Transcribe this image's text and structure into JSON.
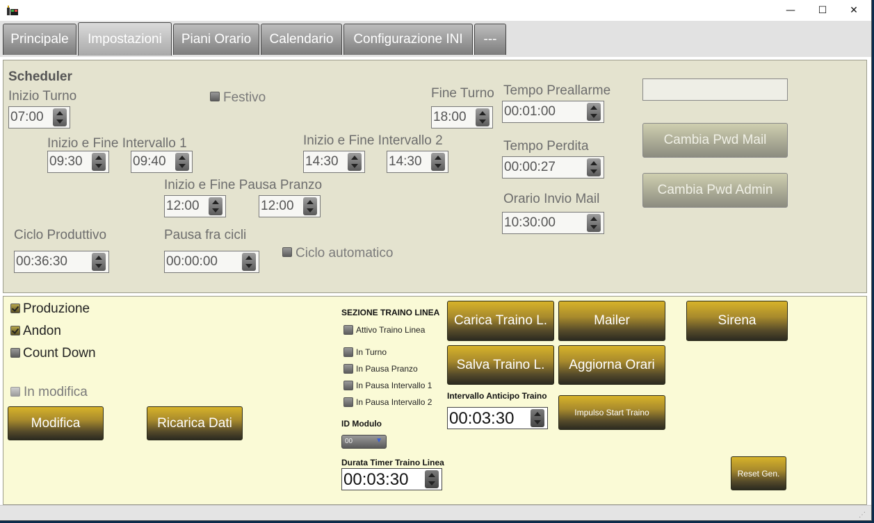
{
  "window": {
    "controls": {
      "minimize": "—",
      "maximize": "☐",
      "close": "✕"
    }
  },
  "tabs": [
    "Principale",
    "Impostazioni",
    "Piani Orario",
    "Calendario",
    "Configurazione INI",
    "---"
  ],
  "scheduler": {
    "heading": "Scheduler",
    "inizio_turno": {
      "label": "Inizio Turno",
      "value": "07:00"
    },
    "festivo": {
      "label": "Festivo",
      "checked": false
    },
    "fine_turno": {
      "label": "Fine Turno",
      "value": "18:00"
    },
    "intervallo1": {
      "label": "Inizio e Fine Intervallo 1",
      "start": "09:30",
      "end": "09:40"
    },
    "intervallo2": {
      "label": "Inizio e Fine Intervallo 2",
      "start": "14:30",
      "end": "14:30"
    },
    "pausa_pranzo": {
      "label": "Inizio e Fine Pausa Pranzo",
      "start": "12:00",
      "end": "12:00"
    },
    "ciclo_produttivo": {
      "label": "Ciclo Produttivo",
      "value": "00:36:30"
    },
    "pausa_cicli": {
      "label": "Pausa fra cicli",
      "value": "00:00:00"
    },
    "ciclo_automatico": {
      "label": "Ciclo automatico",
      "checked": false
    },
    "tempo_preallarme": {
      "label": "Tempo Preallarme",
      "value": "00:01:00"
    },
    "tempo_perdita": {
      "label": "Tempo Perdita",
      "value": "00:00:27"
    },
    "orario_invio_mail": {
      "label": "Orario Invio Mail",
      "value": "10:30:00"
    },
    "password_input": {
      "value": ""
    },
    "cambia_pwd_mail": "Cambia Pwd Mail",
    "cambia_pwd_admin": "Cambia Pwd Admin"
  },
  "lower": {
    "produzione": {
      "label": "Produzione",
      "checked": true
    },
    "andon": {
      "label": "Andon",
      "checked": true
    },
    "count_down": {
      "label": "Count Down",
      "checked": false
    },
    "in_modifica": {
      "label": "In modifica",
      "checked": false
    },
    "modifica": "Modifica",
    "ricarica_dati": "Ricarica Dati",
    "traino": {
      "heading": "SEZIONE TRAINO LINEA",
      "attivo": "Attivo Traino Linea",
      "in_turno": "In Turno",
      "in_pausa_pranzo": "In Pausa Pranzo",
      "in_pausa_int1": "In Pausa Intervallo 1",
      "in_pausa_int2": "In Pausa Intervallo 2",
      "id_modulo_label": "ID Modulo",
      "id_modulo_value": "00",
      "durata_label": "Durata Timer Traino Linea",
      "durata_value": "00:03:30",
      "anticipo_label": "Intervallo Anticipo Traino",
      "anticipo_value": "00:03:30"
    },
    "buttons": {
      "carica_traino": "Carica Traino L.",
      "mailer": "Mailer",
      "sirena": "Sirena",
      "salva_traino": "Salva Traino L.",
      "aggiorna_orari": "Aggiorna Orari",
      "impulso_start": "Impulso Start Traino",
      "reset_gen": "Reset Gen."
    }
  }
}
